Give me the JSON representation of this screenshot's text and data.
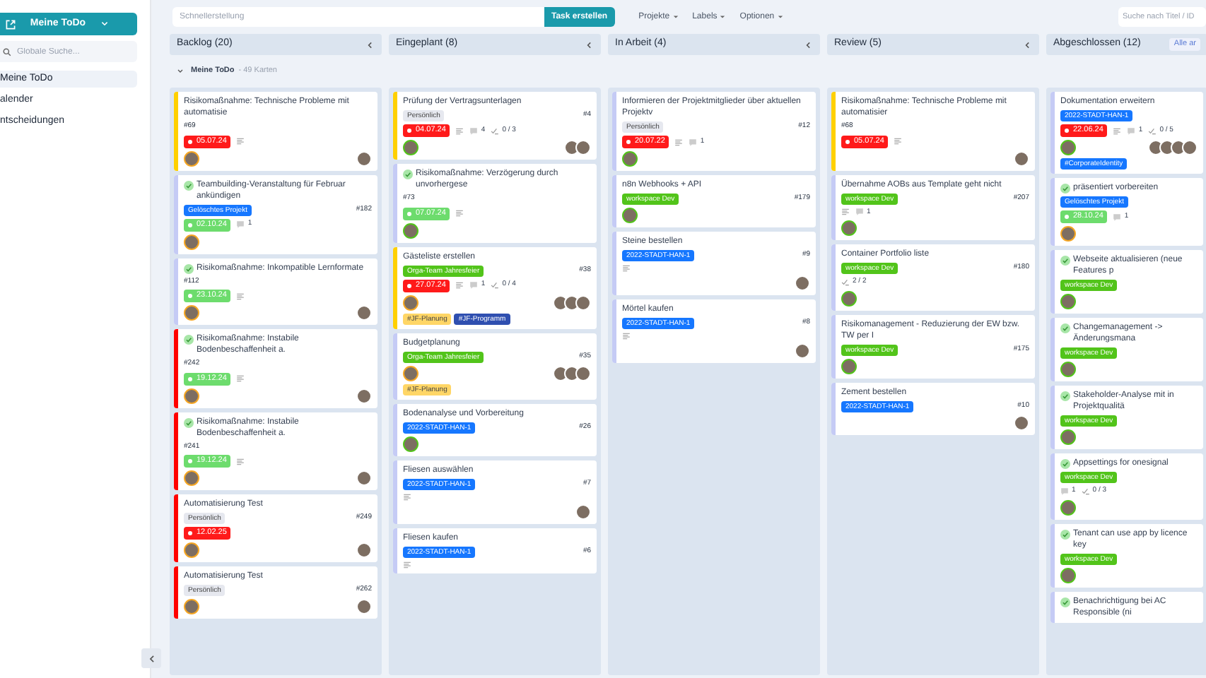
{
  "sidebar": {
    "workspace_button": "Meine ToDo",
    "search": {
      "placeholder": "Globale Suche..."
    },
    "items": [
      {
        "label": "Meine ToDo",
        "selected": true
      },
      {
        "label": "alender",
        "selected": false
      },
      {
        "label": "ntscheidungen",
        "selected": false
      }
    ]
  },
  "toolbar": {
    "quick_create": {
      "placeholder": "Schnellerstellung"
    },
    "create_button": "Task erstellen",
    "menus": [
      "Projekte",
      "Labels",
      "Optionen"
    ],
    "search": {
      "placeholder": "Suche nach Titel / ID"
    }
  },
  "swimlane": {
    "title": "Meine ToDo",
    "count": "- 49 Karten"
  },
  "columns": [
    {
      "title": "Backlog (20)",
      "cards": [
        {
          "title": "Risikomaßnahme: Technische Probleme mit automatisie",
          "done": false,
          "color": "#ffd000",
          "id": "#69",
          "date": {
            "text": "05.07.24",
            "color": "#ff1a1a"
          },
          "desc": true,
          "owner": {
            "color": "#f5a623"
          },
          "members": [
            {
              "kind": "photo"
            }
          ]
        },
        {
          "title": "Teambuilding-Veranstaltung für Februar ankündigen",
          "done": true,
          "color": "#c5cbf5",
          "id": "#182",
          "labels": [
            {
              "text": "Gelöschtes Projekt",
              "color": "#1677ff"
            }
          ],
          "date": {
            "text": "02.10.24",
            "color": "#6ddc6d"
          },
          "comments": "1",
          "owner": {
            "color": "#f5a623"
          }
        },
        {
          "title": "Risikomaßnahme: Inkompatible Lernformate",
          "done": true,
          "color": "#c5cbf5",
          "id": "#112",
          "date": {
            "text": "23.10.24",
            "color": "#6ddc6d"
          },
          "desc": true,
          "owner": {
            "color": "#f5a623"
          },
          "members": [
            {
              "kind": "photo"
            }
          ]
        },
        {
          "title": "Risikomaßnahme: Instabile Bodenbeschaffenheit a.",
          "done": true,
          "color": "#ff0000",
          "id": "#242",
          "date": {
            "text": "19.12.24",
            "color": "#6ddc6d"
          },
          "desc": true,
          "owner": {
            "color": "#f5a623"
          },
          "members": [
            {
              "kind": "photo"
            }
          ]
        },
        {
          "title": "Risikomaßnahme: Instabile Bodenbeschaffenheit a.",
          "done": true,
          "color": "#ff0000",
          "id": "#241",
          "date": {
            "text": "19.12.24",
            "color": "#6ddc6d"
          },
          "desc": true,
          "owner": {
            "color": "#f5a623"
          },
          "members": [
            {
              "kind": "photo"
            }
          ]
        },
        {
          "title": "Automatisierung Test",
          "done": false,
          "color": "#ff0000",
          "id": "#249",
          "labels": [
            {
              "text": "Persönlich",
              "color": "#e6e8ef"
            }
          ],
          "date": {
            "text": "12.02.25",
            "color": "#ff1a1a"
          },
          "owner": {
            "color": "#f5a623"
          },
          "members": [
            {
              "kind": "photo"
            }
          ]
        },
        {
          "title": "Automatisierung Test",
          "done": false,
          "color": "#ff0000",
          "id": "#262",
          "labels": [
            {
              "text": "Persönlich",
              "color": "#e6e8ef"
            }
          ],
          "owner": {
            "color": "#f5a623"
          },
          "members": [
            {
              "kind": "photo"
            }
          ]
        }
      ]
    },
    {
      "title": "Eingeplant (8)",
      "cards": [
        {
          "title": "Prüfung der Vertragsunterlagen",
          "done": false,
          "color": "#ffd000",
          "id": "#4",
          "labels": [
            {
              "text": "Persönlich",
              "color": "#e6e8ef"
            }
          ],
          "date": {
            "text": "04.07.24",
            "color": "#ff1a1a"
          },
          "desc": true,
          "comments": "4",
          "checklist": "0 / 3",
          "owner": {
            "color": "#52c41a"
          },
          "members": [
            {
              "kind": "photo"
            },
            {
              "kind": "photo"
            }
          ]
        },
        {
          "title": "Risikomaßnahme: Verzögerung durch unvorhergese",
          "done": true,
          "color": "#c5cbf5",
          "id": "#73",
          "date": {
            "text": "07.07.24",
            "color": "#6ddc6d"
          },
          "desc": true,
          "owner": {
            "color": "#52c41a"
          }
        },
        {
          "title": "Gästeliste erstellen",
          "done": false,
          "color": "#ffd000",
          "id": "#38",
          "labels": [
            {
              "text": "Orga-Team Jahresfeier",
              "color": "#52c41a"
            }
          ],
          "date": {
            "text": "27.07.24",
            "color": "#ff1a1a"
          },
          "desc": true,
          "comments": "1",
          "checklist": "0 / 4",
          "owner": {
            "color": "#f5a623"
          },
          "members": [
            {
              "kind": "photo"
            },
            {
              "kind": "photo"
            },
            {
              "kind": "photo"
            }
          ],
          "tags": [
            {
              "text": "#JF-Planung",
              "color": "#ffd666"
            },
            {
              "text": "#JF-Programm",
              "color": "#2f4fb0"
            }
          ]
        },
        {
          "title": "Budgetplanung",
          "done": false,
          "color": "#c5cbf5",
          "id": "#35",
          "labels": [
            {
              "text": "Orga-Team Jahresfeier",
              "color": "#52c41a"
            }
          ],
          "owner": {
            "color": "#f5a623"
          },
          "members": [
            {
              "kind": "photo"
            },
            {
              "kind": "photo"
            },
            {
              "kind": "photo"
            }
          ],
          "tags": [
            {
              "text": "#JF-Planung",
              "color": "#ffd666"
            }
          ]
        },
        {
          "title": "Bodenanalyse und Vorbereitung",
          "done": false,
          "color": "#c5cbf5",
          "id": "#26",
          "labels": [
            {
              "text": "2022-STADT-HAN-1",
              "color": "#1677ff"
            }
          ],
          "owner": {
            "color": "#52c41a"
          }
        },
        {
          "title": "Fliesen auswählen",
          "done": false,
          "color": "#c5cbf5",
          "id": "#7",
          "labels": [
            {
              "text": "2022-STADT-HAN-1",
              "color": "#1677ff"
            }
          ],
          "desc": true,
          "members": [
            {
              "kind": "photo"
            }
          ]
        },
        {
          "title": "Fliesen kaufen",
          "done": false,
          "color": "#c5cbf5",
          "id": "#6",
          "labels": [
            {
              "text": "2022-STADT-HAN-1",
              "color": "#1677ff"
            }
          ],
          "desc": true
        }
      ]
    },
    {
      "title": "In Arbeit (4)",
      "cards": [
        {
          "title": "Informieren der Projektmitglieder über aktuellen Projektv",
          "done": false,
          "color": "#c5cbf5",
          "id": "#12",
          "labels": [
            {
              "text": "Persönlich",
              "color": "#e6e8ef"
            }
          ],
          "date": {
            "text": "20.07.22",
            "color": "#ff1a1a"
          },
          "desc": true,
          "comments": "1",
          "owner": {
            "color": "#52c41a"
          }
        },
        {
          "title": "n8n Webhooks + API",
          "done": false,
          "color": "#c5cbf5",
          "id": "#179",
          "labels": [
            {
              "text": "workspace Dev",
              "color": "#52c41a"
            }
          ],
          "owner": {
            "color": "#52c41a"
          }
        },
        {
          "title": "Steine bestellen",
          "done": false,
          "color": "#c5cbf5",
          "id": "#9",
          "labels": [
            {
              "text": "2022-STADT-HAN-1",
              "color": "#1677ff"
            }
          ],
          "desc": true,
          "members": [
            {
              "kind": "photo"
            }
          ]
        },
        {
          "title": "Mörtel kaufen",
          "done": false,
          "color": "#c5cbf5",
          "id": "#8",
          "labels": [
            {
              "text": "2022-STADT-HAN-1",
              "color": "#1677ff"
            }
          ],
          "desc": true,
          "members": [
            {
              "kind": "photo"
            }
          ]
        }
      ]
    },
    {
      "title": "Review (5)",
      "cards": [
        {
          "title": "Risikomaßnahme: Technische Probleme mit automatisier",
          "done": false,
          "color": "#ffd000",
          "id": "#68",
          "date": {
            "text": "05.07.24",
            "color": "#ff1a1a"
          },
          "desc": true,
          "members": [
            {
              "kind": "photo"
            }
          ]
        },
        {
          "title": "Übernahme AOBs aus Template geht nicht",
          "done": false,
          "color": "#c5cbf5",
          "id": "#207",
          "labels": [
            {
              "text": "workspace Dev",
              "color": "#52c41a"
            }
          ],
          "desc": true,
          "comments": "1",
          "owner": {
            "color": "#52c41a"
          }
        },
        {
          "title": "Container Portfolio liste",
          "done": false,
          "color": "#c5cbf5",
          "id": "#180",
          "labels": [
            {
              "text": "workspace Dev",
              "color": "#52c41a"
            }
          ],
          "checklist": "2 / 2",
          "owner": {
            "color": "#52c41a"
          }
        },
        {
          "title": "Risikomanagement - Reduzierung der EW bzw. TW per I",
          "done": false,
          "color": "#c5cbf5",
          "id": "#175",
          "labels": [
            {
              "text": "workspace Dev",
              "color": "#52c41a"
            }
          ],
          "owner": {
            "color": "#52c41a"
          }
        },
        {
          "title": "Zement bestellen",
          "done": false,
          "color": "#c5cbf5",
          "id": "#10",
          "labels": [
            {
              "text": "2022-STADT-HAN-1",
              "color": "#1677ff"
            }
          ],
          "members": [
            {
              "kind": "photo"
            }
          ]
        }
      ]
    },
    {
      "title": "Abgeschlossen (12)",
      "action": "Alle ar",
      "cards": [
        {
          "title": "Dokumentation erweitern",
          "done": false,
          "color": "#c5cbf5",
          "labels": [
            {
              "text": "2022-STADT-HAN-1",
              "color": "#1677ff"
            }
          ],
          "date": {
            "text": "22.06.24",
            "color": "#ff1a1a"
          },
          "desc": true,
          "comments": "1",
          "checklist": "0 / 5",
          "owner": {
            "color": "#52c41a"
          },
          "members": [
            {
              "kind": "photo"
            },
            {
              "kind": "photo"
            },
            {
              "kind": "photo"
            },
            {
              "kind": "photo"
            }
          ],
          "tags": [
            {
              "text": "#CorporateIdentity",
              "color": "#1677ff"
            }
          ]
        },
        {
          "title": "präsentiert vorbereiten",
          "done": true,
          "color": "#c5cbf5",
          "labels": [
            {
              "text": "Gelöschtes Projekt",
              "color": "#1677ff"
            }
          ],
          "date": {
            "text": "28.10.24",
            "color": "#6ddc6d"
          },
          "comments": "1",
          "owner": {
            "color": "#f5a623"
          }
        },
        {
          "title": "Webseite aktualisieren (neue Features p",
          "done": true,
          "color": "#c5cbf5",
          "labels": [
            {
              "text": "workspace Dev",
              "color": "#52c41a"
            }
          ],
          "owner": {
            "color": "#52c41a"
          }
        },
        {
          "title": "Changemanagement -> Änderungsmana",
          "done": true,
          "color": "#c5cbf5",
          "labels": [
            {
              "text": "workspace Dev",
              "color": "#52c41a"
            }
          ],
          "owner": {
            "color": "#52c41a"
          }
        },
        {
          "title": "Stakeholder-Analyse mit in Projektqualitä",
          "done": true,
          "color": "#c5cbf5",
          "labels": [
            {
              "text": "workspace Dev",
              "color": "#52c41a"
            }
          ],
          "owner": {
            "color": "#52c41a"
          }
        },
        {
          "title": "Appsettings for onesignal",
          "done": true,
          "color": "#c5cbf5",
          "labels": [
            {
              "text": "workspace Dev",
              "color": "#52c41a"
            }
          ],
          "comments": "1",
          "checklist": "0 / 3",
          "owner": {
            "color": "#52c41a"
          }
        },
        {
          "title": "Tenant can use app by licence key",
          "done": true,
          "color": "#c5cbf5",
          "labels": [
            {
              "text": "workspace Dev",
              "color": "#52c41a"
            }
          ],
          "owner": {
            "color": "#52c41a"
          }
        },
        {
          "title": "Benachrichtigung bei AC Responsible (ni",
          "done": true,
          "color": "#c5cbf5"
        }
      ]
    }
  ]
}
